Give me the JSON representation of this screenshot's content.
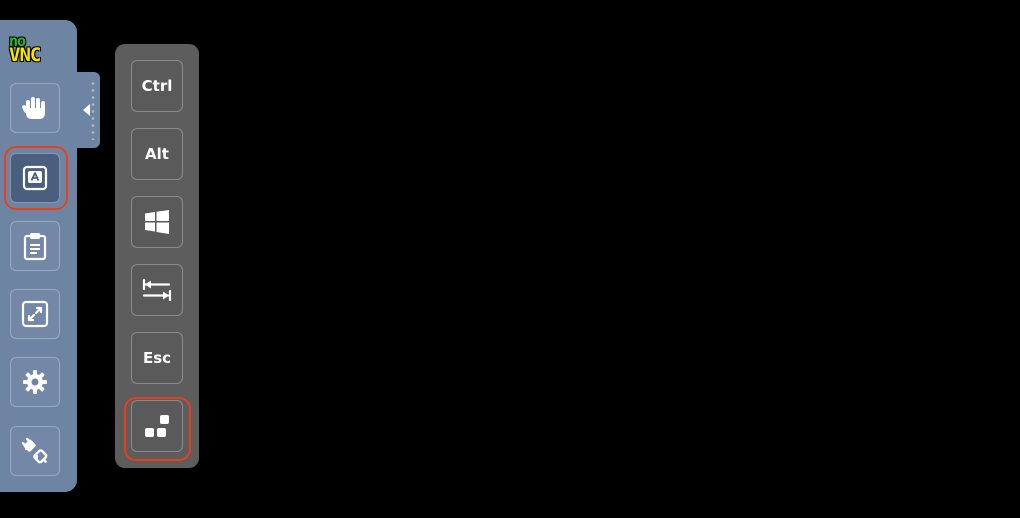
{
  "logo": {
    "line1": "no",
    "line2": "VNC"
  },
  "control_bar": {
    "items": [
      {
        "name": "drag",
        "icon": "hand-icon"
      },
      {
        "name": "extra-keys",
        "icon": "keyboard-key-a-icon",
        "active": true
      },
      {
        "name": "clipboard",
        "icon": "clipboard-icon"
      },
      {
        "name": "fullscreen",
        "icon": "fullscreen-icon"
      },
      {
        "name": "settings",
        "icon": "gear-icon"
      },
      {
        "name": "disconnect",
        "icon": "disconnect-plug-icon"
      }
    ],
    "handle_icon": "chevron-left-icon"
  },
  "extra_keys": {
    "ctrl_label": "Ctrl",
    "alt_label": "Alt",
    "windows_icon": "windows-icon",
    "tab_icon": "tab-icon",
    "esc_label": "Esc",
    "cad_icon": "ctrl-alt-del-icon"
  },
  "colors": {
    "control_bar_bg": "#6e84a3",
    "keys_panel_bg": "#5d5d5d",
    "highlight": "#e8401c",
    "background": "#000000"
  }
}
